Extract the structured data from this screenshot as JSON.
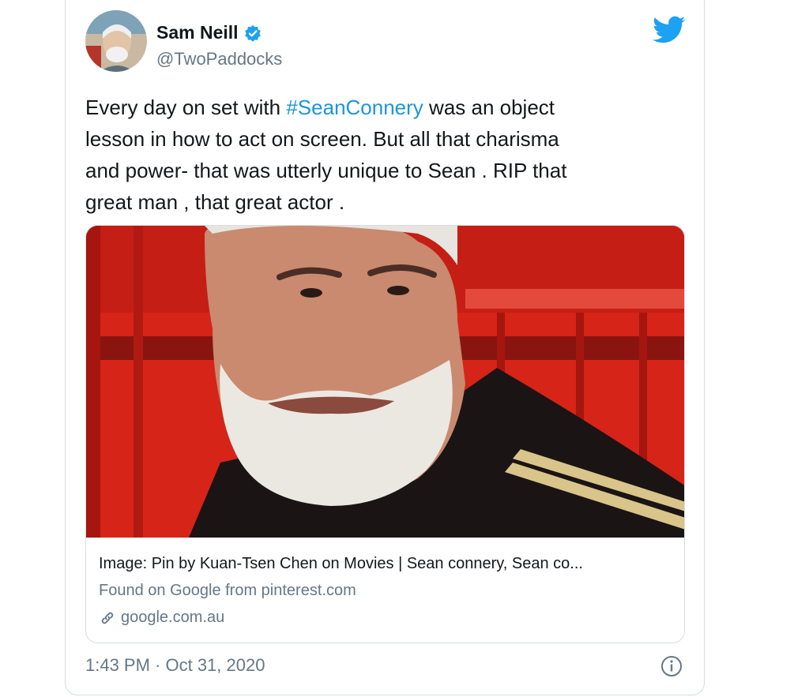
{
  "tweet": {
    "author_name": "Sam Neill",
    "handle": "@TwoPaddocks",
    "text_lines": [
      {
        "before": "Every day on set with ",
        "hashtag": "#SeanConnery",
        "after": " was an object"
      },
      {
        "text": "lesson in how to act on screen.  But all that charisma"
      },
      {
        "text": "and power- that was utterly unique to Sean . RIP that"
      },
      {
        "text": "great man , that great actor ."
      }
    ],
    "timestamp": "1:43 PM · Oct 31, 2020"
  },
  "card": {
    "title": "Image: Pin by Kuan-Tsen Chen on Movies | Sean connery, Sean co...",
    "description": "Found on Google from pinterest.com",
    "link": "google.com.au"
  },
  "icons": {
    "verified": "verified-badge-icon",
    "platform": "twitter-bird-icon",
    "link": "link-icon",
    "info": "info-icon"
  },
  "colors": {
    "brand_blue": "#1da1f2",
    "hashtag": "#1b95e0",
    "secondary_text": "#657786",
    "primary_text": "#14171a",
    "image_red": "#d62418"
  }
}
